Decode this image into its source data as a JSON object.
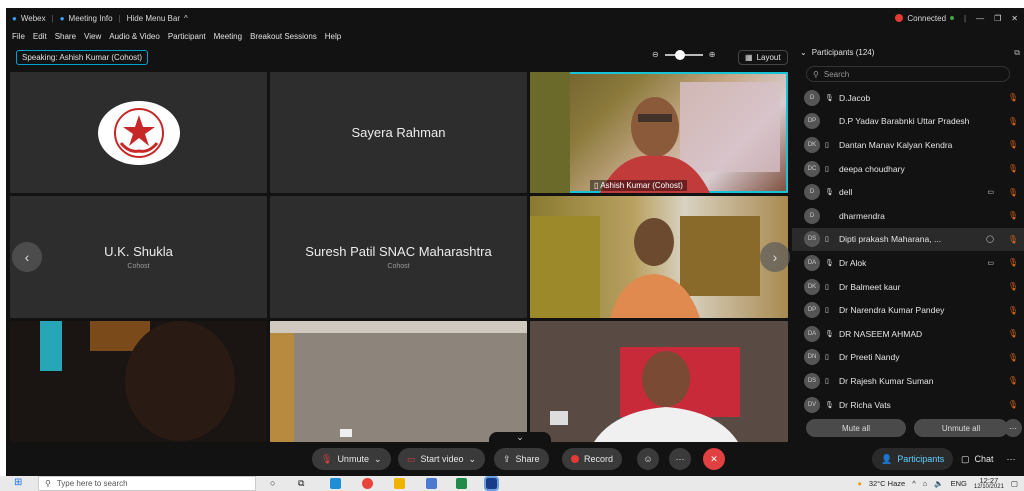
{
  "window": {
    "app_name": "Webex",
    "meeting_info": "Meeting Info",
    "hide_menu": "Hide Menu Bar",
    "connected": "Connected",
    "window_controls": [
      "—",
      "❐",
      "✕"
    ]
  },
  "menu": [
    "File",
    "Edit",
    "Share",
    "View",
    "Audio & Video",
    "Participant",
    "Meeting",
    "Breakout Sessions",
    "Help"
  ],
  "stage": {
    "speaking": "Speaking: Ashish Kumar (Cohost)",
    "layout_label": "Layout",
    "zoom_level": 0.4,
    "tiles": [
      {
        "name": "",
        "sub": "",
        "kind": "logo"
      },
      {
        "name": "Sayera Rahman",
        "sub": "",
        "kind": "name"
      },
      {
        "name": "Ashish Kumar (Cohost)",
        "sub": "",
        "kind": "video"
      },
      {
        "name": "U.K. Shukla",
        "sub": "Cohost",
        "kind": "name"
      },
      {
        "name": "Suresh Patil SNAC Maharashtra",
        "sub": "Cohost",
        "kind": "name"
      },
      {
        "name": "",
        "sub": "",
        "kind": "video"
      },
      {
        "name": "",
        "sub": "",
        "kind": "video"
      },
      {
        "name": "",
        "sub": "",
        "kind": "video"
      },
      {
        "name": "",
        "sub": "",
        "kind": "video"
      }
    ]
  },
  "toolbar": {
    "unmute": "Unmute",
    "start_video": "Start video",
    "share": "Share",
    "record": "Record",
    "participants": "Participants",
    "chat": "Chat"
  },
  "participants": {
    "title": "Participants (124)",
    "search_placeholder": "Search",
    "rows": [
      {
        "initials": "D",
        "name": "D.Jacob",
        "mic": "🎙",
        "cam": ""
      },
      {
        "initials": "DP",
        "name": "D.P Yadav Barabnki Uttar Pradesh",
        "mic": "",
        "cam": ""
      },
      {
        "initials": "DK",
        "name": "Dantan Manav Kalyan Kendra",
        "mic": "▯",
        "cam": ""
      },
      {
        "initials": "DC",
        "name": "deepa choudhary",
        "mic": "▯",
        "cam": ""
      },
      {
        "initials": "D",
        "name": "dell",
        "mic": "🎙",
        "cam": "▭"
      },
      {
        "initials": "D",
        "name": "dharmendra",
        "mic": "",
        "cam": ""
      },
      {
        "initials": "DS",
        "name": "Dipti prakash Maharana, ...",
        "mic": "▯",
        "cam": "◯"
      },
      {
        "initials": "DA",
        "name": "Dr Alok",
        "mic": "🎙",
        "cam": "▭"
      },
      {
        "initials": "DK",
        "name": "Dr Balmeet kaur",
        "mic": "▯",
        "cam": ""
      },
      {
        "initials": "DP",
        "name": "Dr Narendra Kumar Pandey",
        "mic": "▯",
        "cam": ""
      },
      {
        "initials": "DA",
        "name": "DR NASEEM AHMAD",
        "mic": "🎙",
        "cam": ""
      },
      {
        "initials": "DN",
        "name": "Dr Preeti Nandy",
        "mic": "▯",
        "cam": ""
      },
      {
        "initials": "DS",
        "name": "Dr Rajesh Kumar Suman",
        "mic": "▯",
        "cam": ""
      },
      {
        "initials": "DV",
        "name": "Dr Richa Vats",
        "mic": "🎙",
        "cam": ""
      }
    ],
    "mute_all": "Mute all",
    "unmute_all": "Unmute all"
  },
  "taskbar": {
    "search_placeholder": "Type here to search",
    "weather": "32°C Haze",
    "lang": "ENG",
    "time": "12:27",
    "date": "12/10/2021"
  }
}
